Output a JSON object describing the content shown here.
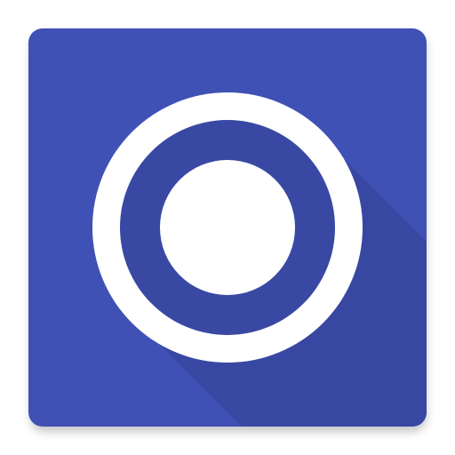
{
  "app_icon": {
    "icon_name": "circle-record-icon",
    "colors": {
      "tile": "#3f51b5",
      "long_shadow": "#3848a2",
      "ring": "#ffffff",
      "inner_ring": "#3949a3",
      "center_dot": "#ffffff"
    }
  }
}
